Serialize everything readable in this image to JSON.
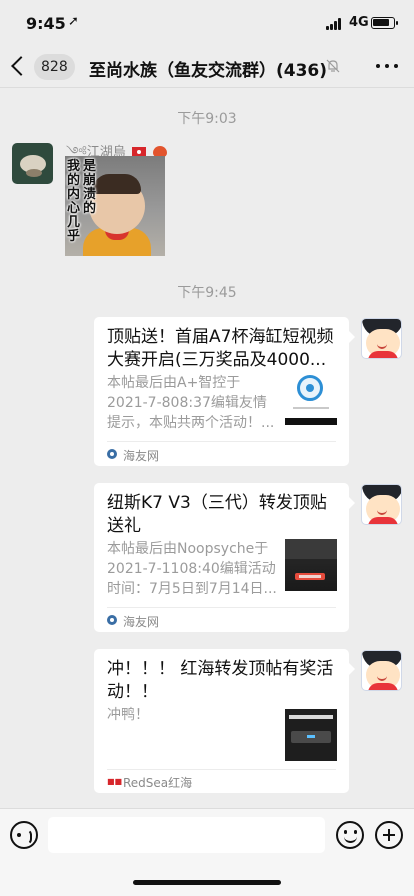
{
  "status_bar": {
    "time": "9:45",
    "location_glyph": "➚",
    "network": "4G",
    "signal_icon": "signal-bars-icon",
    "battery_icon": "battery-icon"
  },
  "nav": {
    "unread_count": "828",
    "title": "至尚水族（鱼友交流群）(436)",
    "mute_icon": "bell-slash-icon",
    "more_icon": "more-dots-icon",
    "back_icon": "chevron-left-icon"
  },
  "messages": {
    "time_1": "下午9:03",
    "incoming": {
      "sender_name": "༺江湖烏",
      "sticker_text": {
        "col1": "我的内心几乎",
        "col2": "是崩溃的"
      }
    },
    "time_2": "下午9:45",
    "cards": [
      {
        "title": "顶贴送！首届A7杯海缸短视频大赛开启(三万奖品及4000...",
        "desc": "本帖最后由A+智控于2021-7-808:37编辑友情提示，本贴共两个活动！...",
        "source": "海友网"
      },
      {
        "title": "纽斯K7 V3（三代）转发顶贴送礼",
        "desc": "本帖最后由Noopsyche于2021-7-1108:40编辑活动时间：7月5日到7月14日...",
        "source": "海友网"
      },
      {
        "title": "冲！！！ 红海转发顶帖有奖活动！！",
        "desc": "冲鸭！",
        "source": "RedSea红海"
      }
    ]
  },
  "input_bar": {
    "voice_icon": "voice-icon",
    "emoji_icon": "emoji-icon",
    "plus_icon": "plus-icon"
  },
  "colors": {
    "background": "#ededed",
    "bubble": "#ffffff",
    "muted_text": "#9b9b9b"
  }
}
